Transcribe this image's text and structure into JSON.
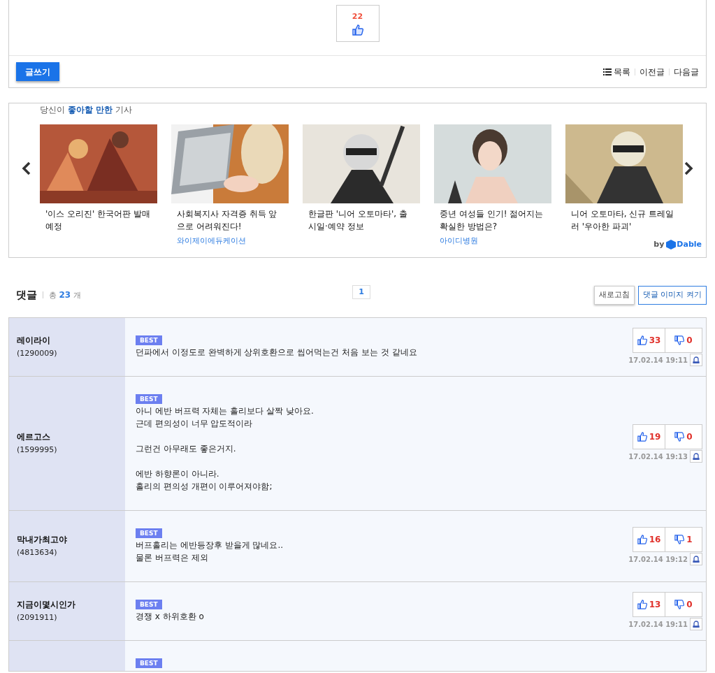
{
  "post_actions": {
    "like_count": "22",
    "write_button": "글쓰기",
    "nav": [
      "목록",
      "이전글",
      "다음글"
    ]
  },
  "recommendations": {
    "heading": "당신이 **좋아할 만한** 기사",
    "by": "by",
    "brand": "Dable",
    "articles": [
      {
        "title": "'이스 오리진' 한국어판 발매 예정",
        "kind": "picture"
      },
      {
        "title": "사회복지사 자격증 취득 앞으로 어려워진다!",
        "source": "와이제이에듀케이션",
        "kind": "picture"
      },
      {
        "title": "한글판 '니어 오토마타', 출시일·예약 정보",
        "kind": "picture"
      },
      {
        "title": "중년 여성들 인기! 젊어지는 확실한 방법은?",
        "source": "아이디병원",
        "kind": "picture"
      },
      {
        "title": "니어 오토마타, 신규 트레일러 '우아한 파괴'",
        "kind": "picture"
      }
    ]
  },
  "comments": {
    "title": "댓글",
    "total_label": "총",
    "total": "23",
    "unit": "개",
    "pages": [
      {
        "label": "1",
        "selected": true
      }
    ],
    "refresh_button": "새로고침",
    "image_button": "댓글 이미지 켜기",
    "items": [
      {
        "author": "레이라이",
        "user_id": "(1290009)",
        "badge": "BEST",
        "paragraphs": [
          [
            "던파에서 이정도로 완벽하게 상위호환으로 씹어먹는건 처음 보는 것 같네요"
          ]
        ],
        "likes": "33",
        "dislikes": "0",
        "time": "17.02.14 19:11"
      },
      {
        "author": "에르고스",
        "user_id": "(1599995)",
        "badge": "BEST",
        "paragraphs": [
          [
            "아니 에반 버프력 자체는 홀리보다 살짝 낮아요.",
            "근데 편의성이 너무 압도적이라"
          ],
          [
            "그런건 아무래도 좋은거지."
          ],
          [
            "에반 하향론이 아니라.",
            "홀리의 편의성 개편이 이루어져야함;"
          ]
        ],
        "likes": "19",
        "dislikes": "0",
        "time": "17.02.14 19:13"
      },
      {
        "author": "막내가최고야",
        "user_id": "(4813634)",
        "badge": "BEST",
        "paragraphs": [
          [
            "버프홀리는 에반등장후 받을게 많네요..",
            "물론 버프력은 제외"
          ]
        ],
        "likes": "16",
        "dislikes": "1",
        "time": "17.02.14 19:12"
      },
      {
        "author": "지금이몇시인가",
        "user_id": "(2091911)",
        "badge": "BEST",
        "paragraphs": [
          [
            "경쟁 x 하위호환 o"
          ]
        ],
        "likes": "13",
        "dislikes": "0",
        "time": "17.02.14 19:11"
      },
      {
        "badge": "BEST"
      }
    ]
  }
}
